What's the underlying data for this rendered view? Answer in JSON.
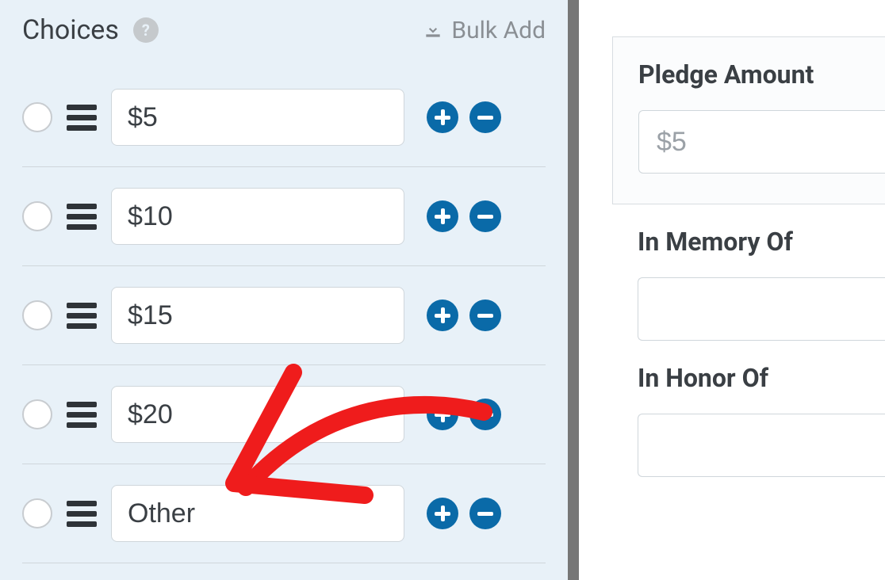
{
  "section": {
    "title": "Choices"
  },
  "bulk_add": {
    "label": "Bulk Add"
  },
  "choices": [
    {
      "value": "$5"
    },
    {
      "value": "$10"
    },
    {
      "value": "$15"
    },
    {
      "value": "$20"
    },
    {
      "value": "Other"
    }
  ],
  "preview": {
    "pledge": {
      "label": "Pledge Amount",
      "value": "$5"
    },
    "memory": {
      "label": "In Memory Of",
      "value": ""
    },
    "honor": {
      "label": "In Honor Of",
      "value": ""
    }
  },
  "colors": {
    "accent": "#0a6aa8",
    "annotation": "#ef1c1c"
  }
}
